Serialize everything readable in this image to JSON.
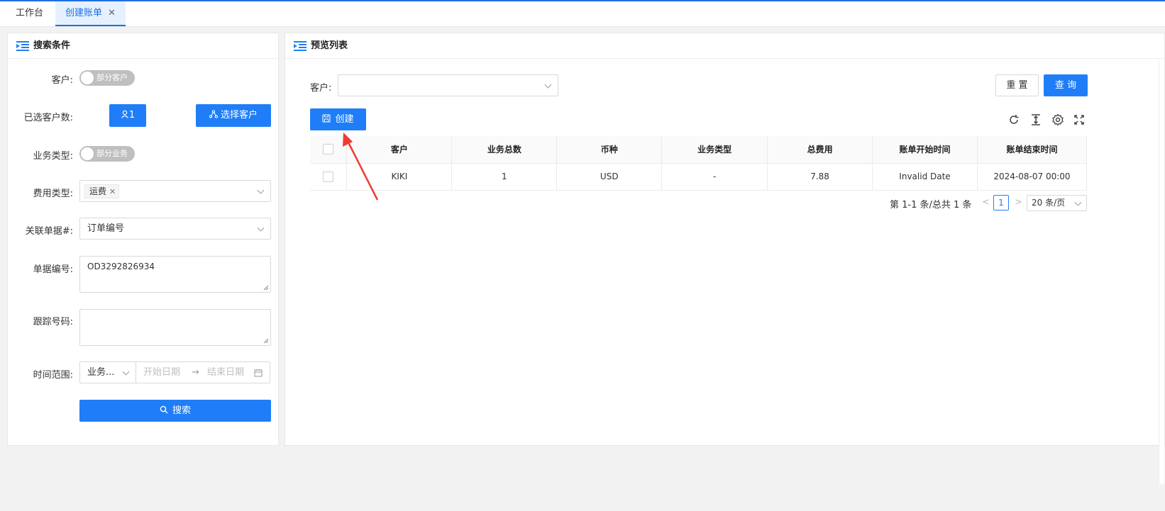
{
  "tabs": [
    {
      "label": "工作台"
    },
    {
      "label": "创建账单",
      "close": "✕"
    }
  ],
  "search_panel": {
    "title": "搜索条件",
    "customer_label": "客户:",
    "customer_switch": "部分客户",
    "selected_count_label": "已选客户数:",
    "selected_count_value": "1",
    "select_customer_button": "选择客户",
    "business_type_label": "业务类型:",
    "business_type_switch": "部分业务",
    "fee_type_label": "费用类型:",
    "fee_type_tag": "运费",
    "related_doc_label": "关联单据#:",
    "related_doc_value": "订单编号",
    "doc_number_label": "单据编号:",
    "doc_number_value": "OD3292826934",
    "tracking_label": "跟踪号码:",
    "tracking_value": "",
    "time_range_label": "时间范围:",
    "time_type_value": "业务...",
    "start_placeholder": "开始日期",
    "end_placeholder": "结束日期",
    "range_arrow": "→",
    "search_button": "搜索"
  },
  "preview_panel": {
    "title": "预览列表",
    "customer_label": "客户:",
    "customer_value": "",
    "reset_button": "重 置",
    "query_button": "查 询",
    "create_button": "创建",
    "table": {
      "headers": [
        "客户",
        "业务总数",
        "币种",
        "业务类型",
        "总费用",
        "账单开始时间",
        "账单结束时间"
      ],
      "rows": [
        [
          "KIKI",
          "1",
          "USD",
          "-",
          "7.88",
          "Invalid Date",
          "2024-08-07 00:00"
        ]
      ]
    },
    "pagination": {
      "summary": "第 1-1 条/总共 1 条",
      "prev": "<",
      "current_page": "1",
      "next": ">",
      "page_size": "20 条/页"
    }
  },
  "colors": {
    "primary": "#1f7ef7",
    "annotation_arrow": "#f03a32"
  }
}
